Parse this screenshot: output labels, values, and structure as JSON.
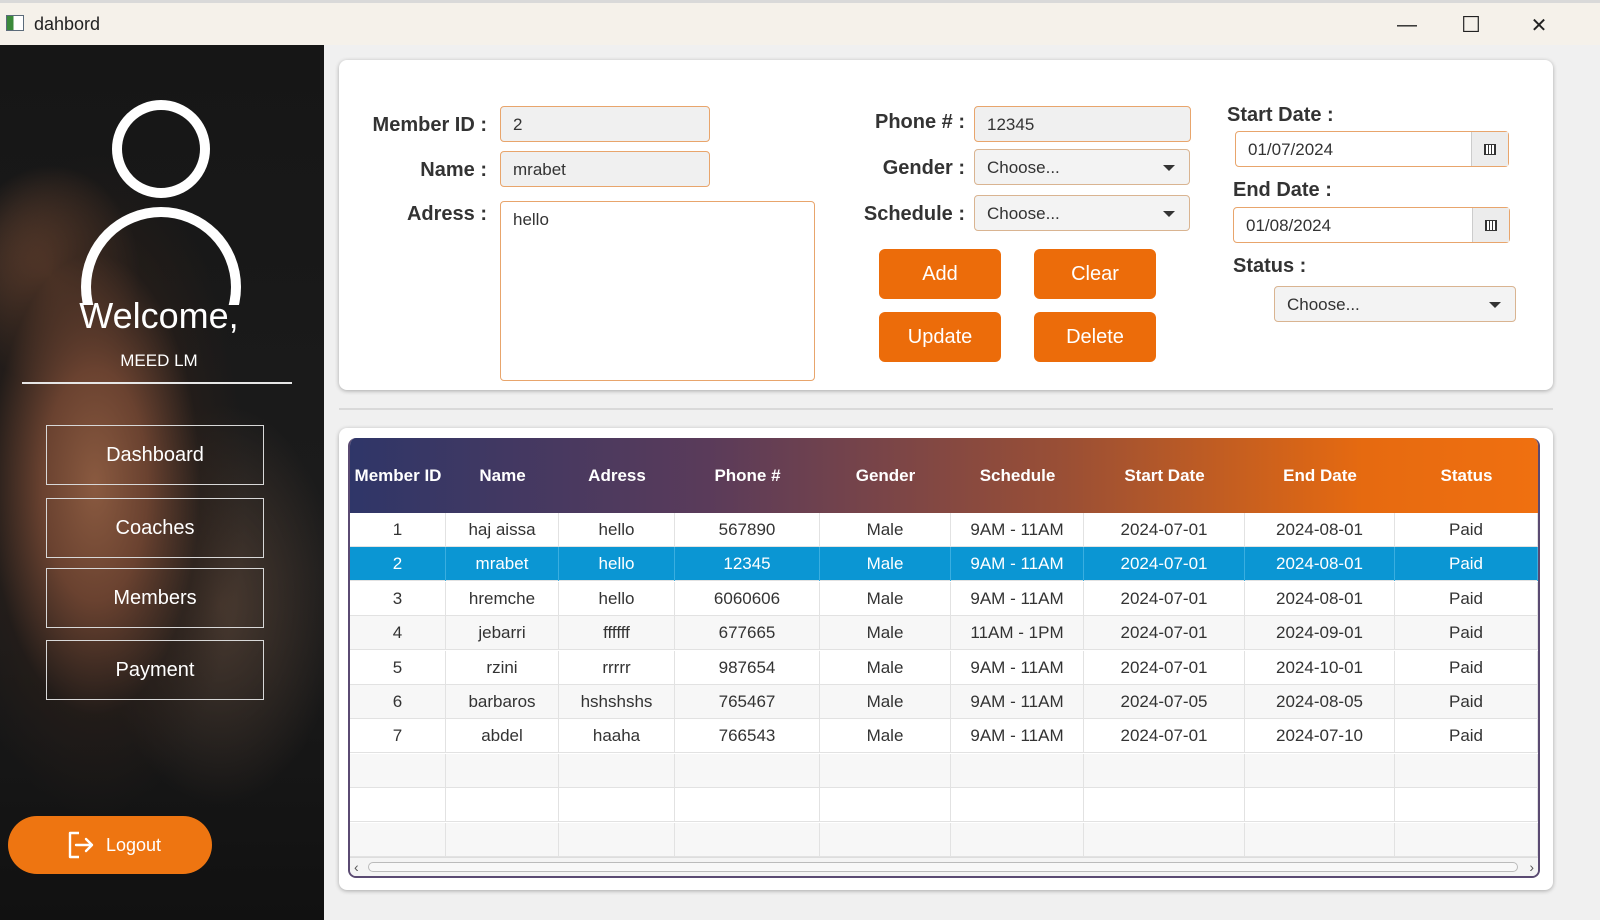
{
  "window": {
    "title": "dahbord",
    "controls": {
      "minimize": "—",
      "maximize": "☐",
      "close": "✕"
    }
  },
  "sidebar": {
    "welcome": "Welcome,",
    "username": "MEED LM",
    "nav": [
      {
        "label": "Dashboard"
      },
      {
        "label": "Coaches"
      },
      {
        "label": "Members"
      },
      {
        "label": "Payment"
      }
    ],
    "logout": "Logout"
  },
  "form": {
    "member_id_label": "Member ID :",
    "member_id_value": "2",
    "name_label": "Name :",
    "name_value": "mrabet",
    "adress_label": "Adress :",
    "adress_value": "hello",
    "phone_label": "Phone # :",
    "phone_value": "12345",
    "gender_label": "Gender :",
    "gender_value": "Choose...",
    "schedule_label": "Schedule :",
    "schedule_value": "Choose...",
    "start_date_label": "Start Date :",
    "start_date_value": "01/07/2024",
    "end_date_label": "End Date :",
    "end_date_value": "01/08/2024",
    "status_label": "Status :",
    "status_value": "Choose...",
    "buttons": {
      "add": "Add",
      "clear": "Clear",
      "update": "Update",
      "delete": "Delete"
    }
  },
  "table": {
    "columns": [
      "Member ID",
      "Name",
      "Adress",
      "Phone #",
      "Gender",
      "Schedule",
      "Start Date",
      "End Date",
      "Status"
    ],
    "rows": [
      [
        "1",
        "haj aissa",
        "hello",
        "567890",
        "Male",
        "9AM - 11AM",
        "2024-07-01",
        "2024-08-01",
        "Paid"
      ],
      [
        "2",
        "mrabet",
        "hello",
        "12345",
        "Male",
        "9AM - 11AM",
        "2024-07-01",
        "2024-08-01",
        "Paid"
      ],
      [
        "3",
        "hremche",
        "hello",
        "6060606",
        "Male",
        "9AM - 11AM",
        "2024-07-01",
        "2024-08-01",
        "Paid"
      ],
      [
        "4",
        "jebarri",
        "ffffff",
        "677665",
        "Male",
        "11AM - 1PM",
        "2024-07-01",
        "2024-09-01",
        "Paid"
      ],
      [
        "5",
        "rzini",
        "rrrrr",
        "987654",
        "Male",
        "9AM - 11AM",
        "2024-07-01",
        "2024-10-01",
        "Paid"
      ],
      [
        "6",
        "barbaros",
        "hshshshs",
        "765467",
        "Male",
        "9AM - 11AM",
        "2024-07-05",
        "2024-08-05",
        "Paid"
      ],
      [
        "7",
        "abdel",
        "haaha",
        "766543",
        "Male",
        "9AM - 11AM",
        "2024-07-01",
        "2024-07-10",
        "Paid"
      ]
    ],
    "selected_row": 1,
    "empty_rows": 3
  },
  "colors": {
    "accent": "#ec6c0a",
    "selection": "#0b96d3",
    "header_start": "#2f3668",
    "header_end": "#f07010"
  }
}
